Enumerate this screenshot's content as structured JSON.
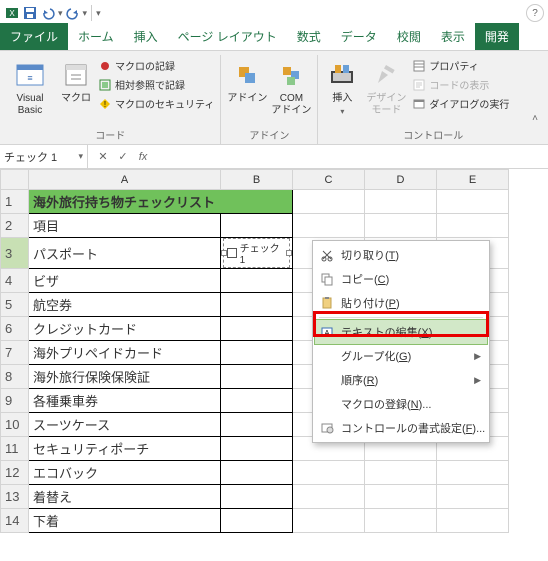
{
  "titlebar": {
    "help": "?"
  },
  "tabs": {
    "file": "ファイル",
    "items": [
      "ホーム",
      "挿入",
      "ページ レイアウト",
      "数式",
      "データ",
      "校閲",
      "表示",
      "開発"
    ],
    "active_index": 7
  },
  "ribbon": {
    "code": {
      "vb": "Visual Basic",
      "macro": "マクロ",
      "record": "マクロの記録",
      "relref": "相対参照で記録",
      "security": "マクロのセキュリティ",
      "label": "コード"
    },
    "addins": {
      "addin": "アドイン",
      "com": "COM\nアドイン",
      "label": "アドイン"
    },
    "controls": {
      "insert": "挿入",
      "design": "デザイン\nモード",
      "prop": "プロパティ",
      "viewcode": "コードの表示",
      "dialog": "ダイアログの実行",
      "label": "コントロール"
    }
  },
  "fbar": {
    "name": "チェック 1",
    "fx": "fx"
  },
  "columns": [
    "A",
    "B",
    "C",
    "D",
    "E"
  ],
  "rowcount": 14,
  "sheet": {
    "title": "海外旅行持ち物チェックリスト",
    "header": "項目",
    "items": [
      "パスポート",
      "ビザ",
      "航空券",
      "クレジットカード",
      "海外プリペイドカード",
      "海外旅行保険保険証",
      "各種乗車券",
      "スーツケース",
      "セキュリティポーチ",
      "エコバック",
      "着替え",
      "下着"
    ],
    "checkbox_label": "チェック 1"
  },
  "ctx": {
    "cut": "切り取り",
    "cut_k": "T",
    "copy": "コピー",
    "copy_k": "C",
    "paste": "貼り付け",
    "paste_k": "P",
    "edittext": "テキストの編集",
    "edittext_k": "X",
    "group": "グループ化",
    "group_k": "G",
    "order": "順序",
    "order_k": "R",
    "assign": "マクロの登録",
    "assign_k": "N",
    "format": "コントロールの書式設定",
    "format_k": "F"
  }
}
